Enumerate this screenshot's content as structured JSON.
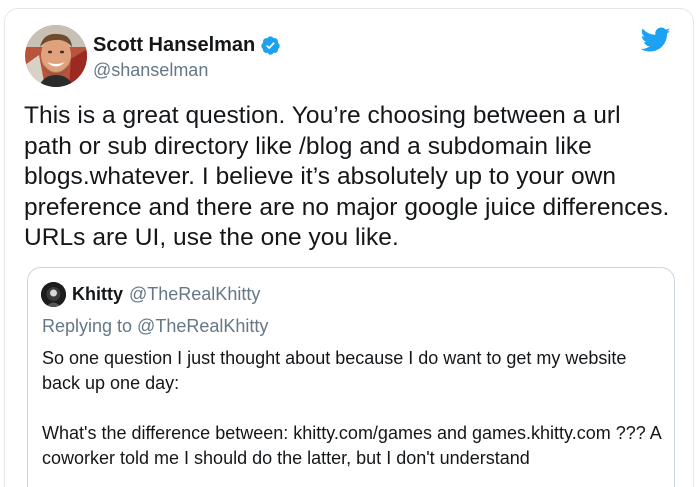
{
  "tweet": {
    "author": {
      "display_name": "Scott Hanselman",
      "handle": "@shanselman",
      "verified": true,
      "avatar_icon": "profile-photo"
    },
    "platform_icon": "twitter-bird-icon",
    "text": "This is a great question. You’re choosing between a url path or sub directory like /blog and a subdomain like blogs.whatever. I believe it’s absolutely up to your own preference and there are no major google juice differences. URLs are UI, use the one you like."
  },
  "quoted_tweet": {
    "author": {
      "display_name": "Khitty",
      "handle": "@TheRealKhitty"
    },
    "reply_context": "Replying to @TheRealKhitty",
    "text": "So one question I just thought about because I do want to get my website back up one day:\n\nWhat's the difference between: khitty.com/games and games.khitty.com ??? A coworker told me I should do the latter, but I don't understand"
  },
  "colors": {
    "text_primary": "#14171a",
    "text_secondary": "#657786",
    "twitter_blue": "#1da1f2",
    "border": "#ccd6dd"
  }
}
